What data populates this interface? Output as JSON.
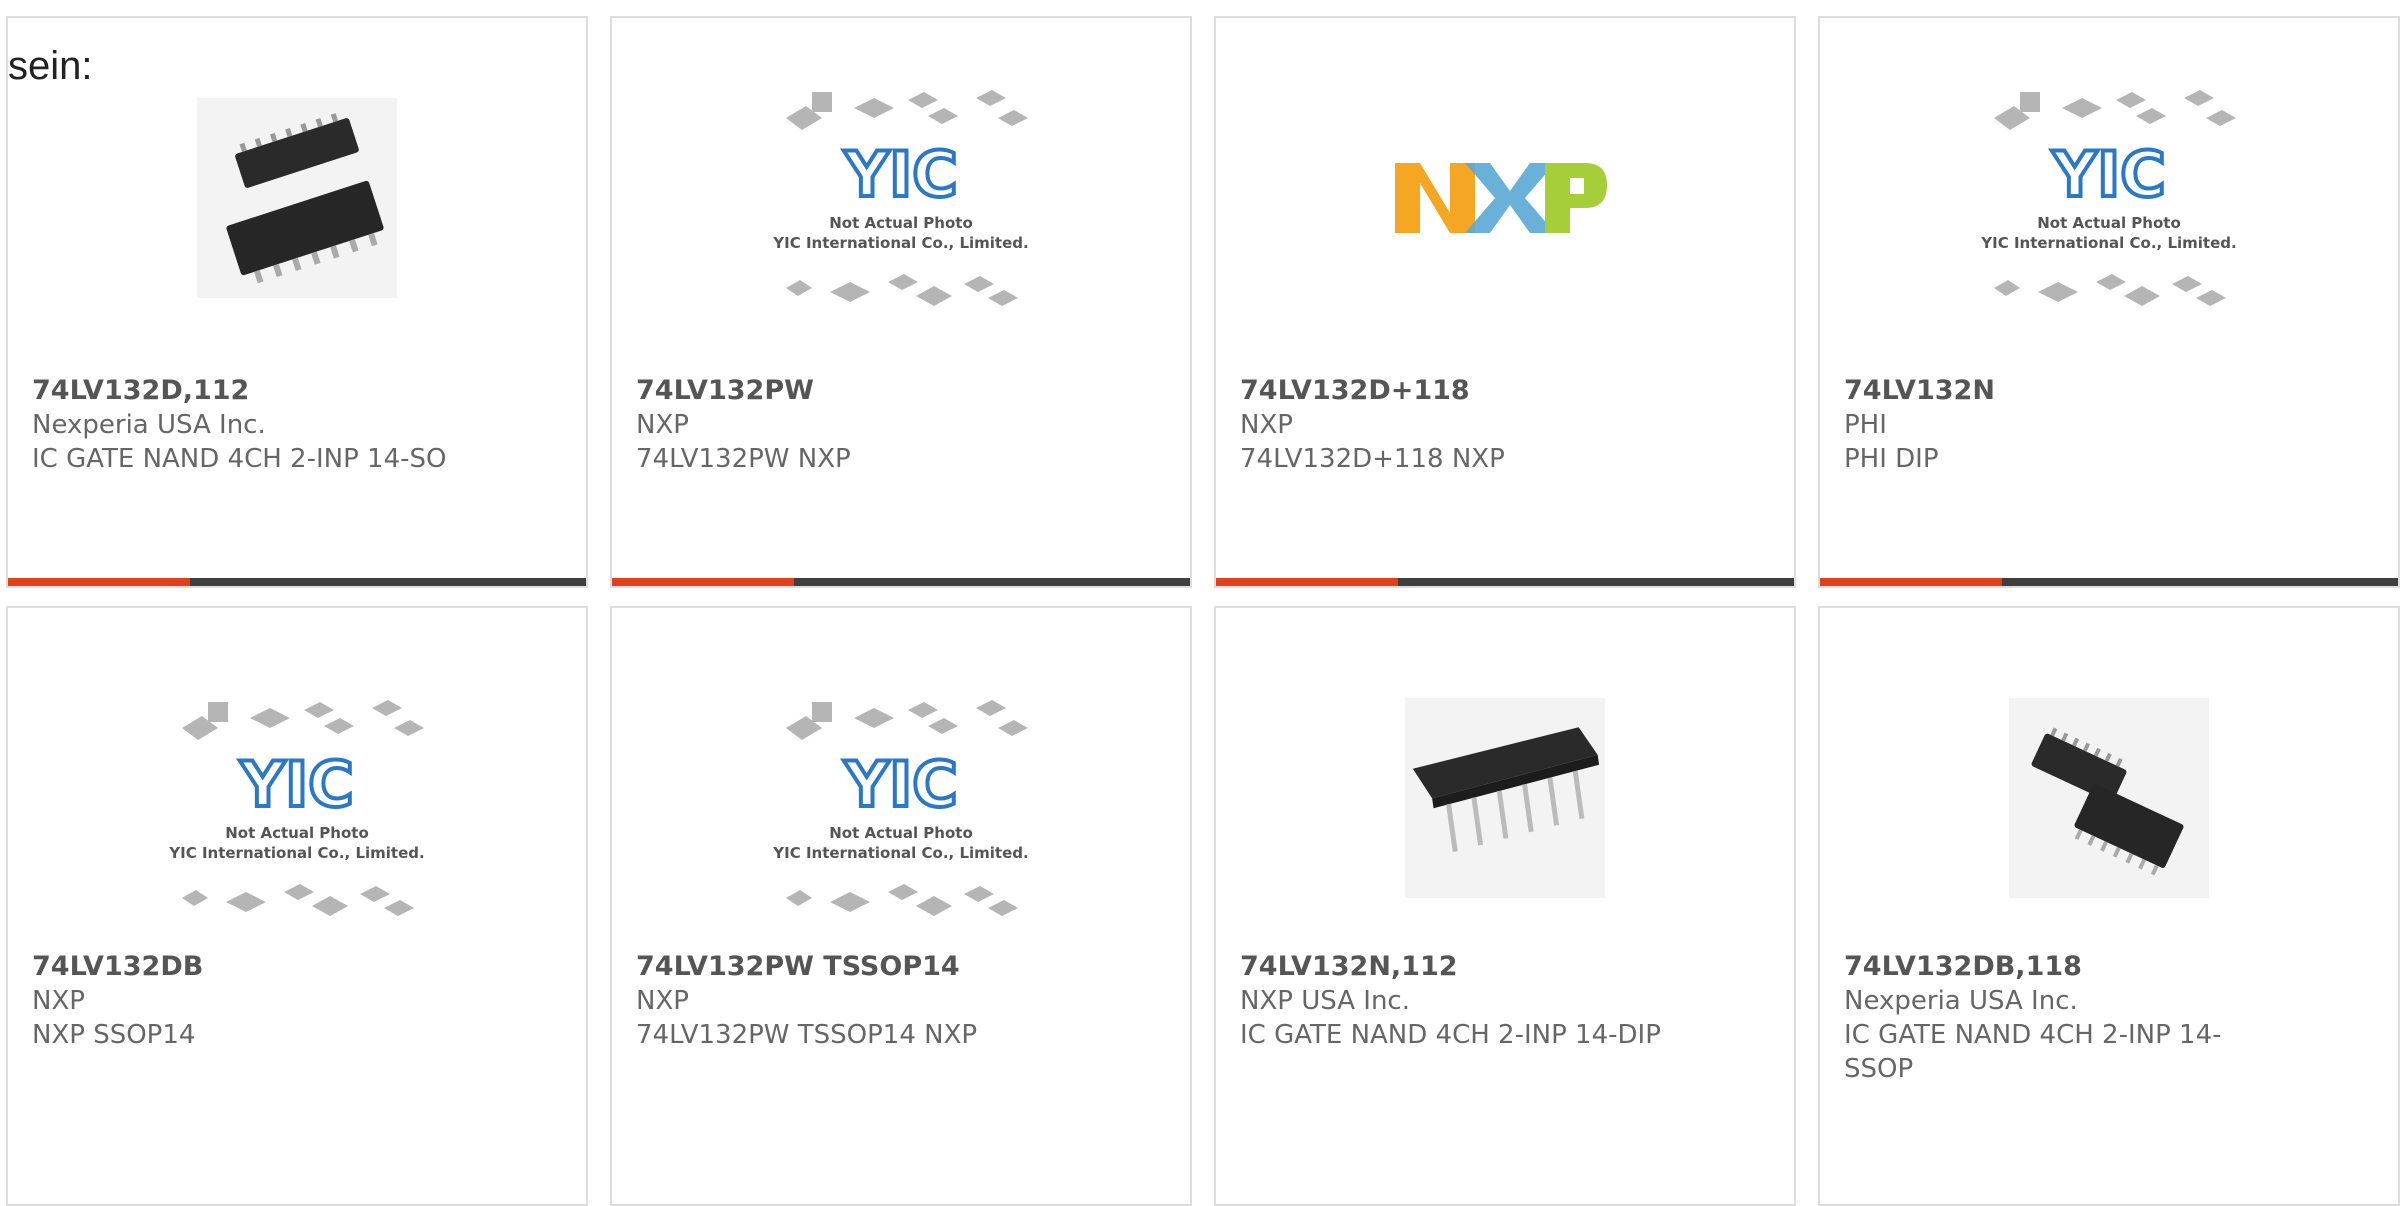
{
  "intro_text": "sein:",
  "accent_color": "#e0401a",
  "bar_color": "#3f3f3f",
  "placeholder": {
    "logo": "YIC",
    "line1": "Not Actual Photo",
    "line2": "YIC International Co., Limited."
  },
  "nxp_logo": "NXP",
  "products": [
    {
      "part": "74LV132D,112",
      "manufacturer": "Nexperia USA Inc.",
      "description": "IC GATE NAND 4CH 2-INP 14-SO",
      "image": "so14-chip-photo"
    },
    {
      "part": "74LV132PW",
      "manufacturer": "NXP",
      "description": "74LV132PW NXP",
      "image": "yic-placeholder"
    },
    {
      "part": "74LV132D+118",
      "manufacturer": "NXP",
      "description": "74LV132D+118 NXP",
      "image": "nxp-logo"
    },
    {
      "part": "74LV132N",
      "manufacturer": "PHI",
      "description": "PHI DIP",
      "image": "yic-placeholder"
    },
    {
      "part": "74LV132DB",
      "manufacturer": "NXP",
      "description": "NXP SSOP14",
      "image": "yic-placeholder"
    },
    {
      "part": "74LV132PW TSSOP14",
      "manufacturer": "NXP",
      "description": "74LV132PW TSSOP14 NXP",
      "image": "yic-placeholder"
    },
    {
      "part": "74LV132N,112",
      "manufacturer": "NXP USA Inc.",
      "description": "IC GATE NAND 4CH 2-INP 14-DIP",
      "image": "dip14-chip-photo"
    },
    {
      "part": "74LV132DB,118",
      "manufacturer": "Nexperia USA Inc.",
      "description": "IC GATE NAND 4CH 2-INP 14-SSOP",
      "image": "ssop14-chip-photo"
    }
  ]
}
